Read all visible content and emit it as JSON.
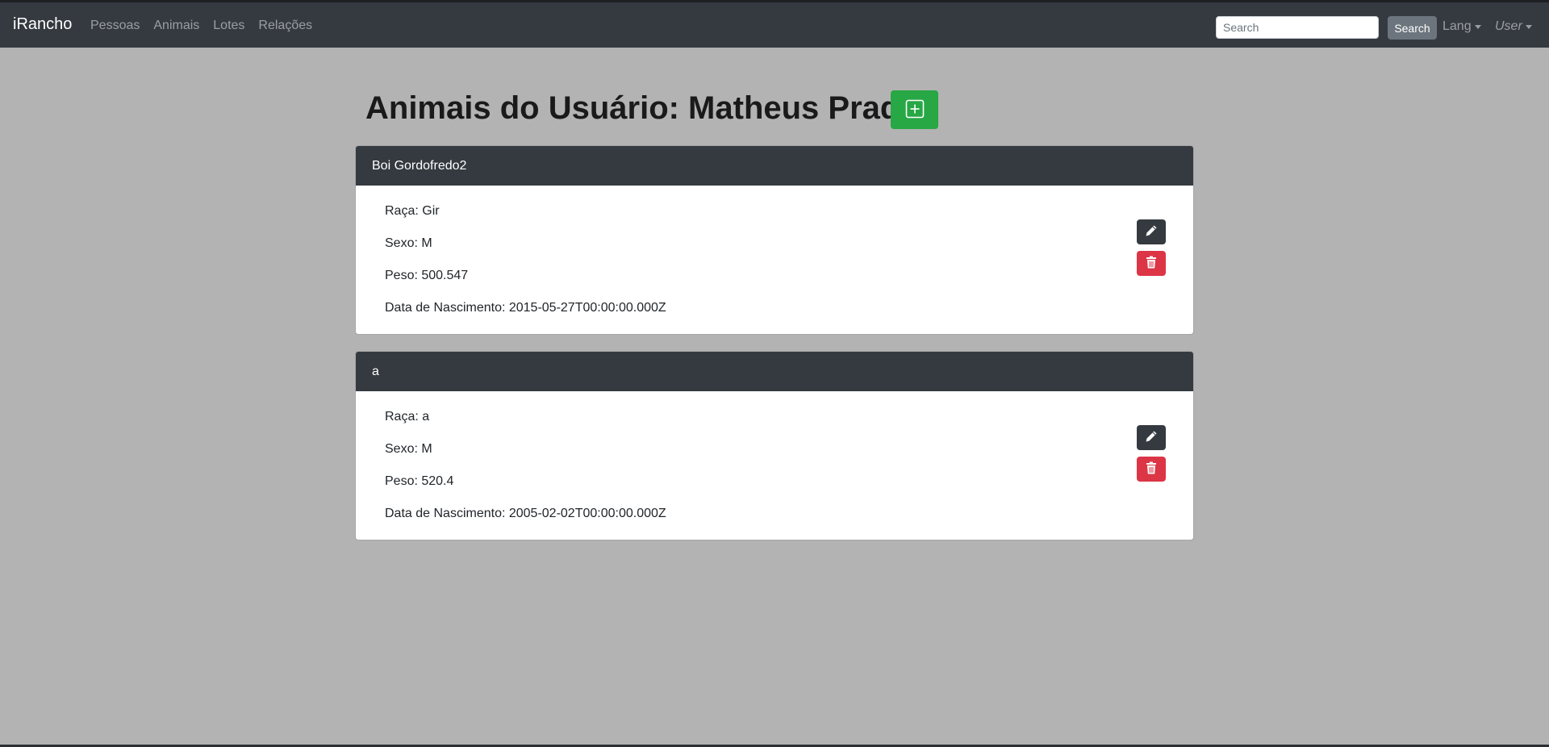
{
  "navbar": {
    "brand": "iRancho",
    "links": [
      "Pessoas",
      "Animais",
      "Lotes",
      "Relações"
    ],
    "search_placeholder": "Search",
    "search_button": "Search",
    "lang_label": "Lang",
    "user_label": "User"
  },
  "page": {
    "title": "Animais do Usuário: Matheus Prado",
    "add_icon": "plus-square-icon"
  },
  "animals": [
    {
      "name": "Boi Gordofredo2",
      "raca": "Raça: Gir",
      "sexo": "Sexo: M",
      "peso": "Peso: 500.547",
      "nascimento": "Data de Nascimento: 2015-05-27T00:00:00.000Z"
    },
    {
      "name": "a",
      "raca": "Raça: a",
      "sexo": "Sexo: M",
      "peso": "Peso: 520.4",
      "nascimento": "Data de Nascimento: 2005-02-02T00:00:00.000Z"
    }
  ],
  "colors": {
    "navbar": "#343a40",
    "background": "#b3b3b3",
    "add": "#28a745",
    "delete": "#dc3545"
  }
}
